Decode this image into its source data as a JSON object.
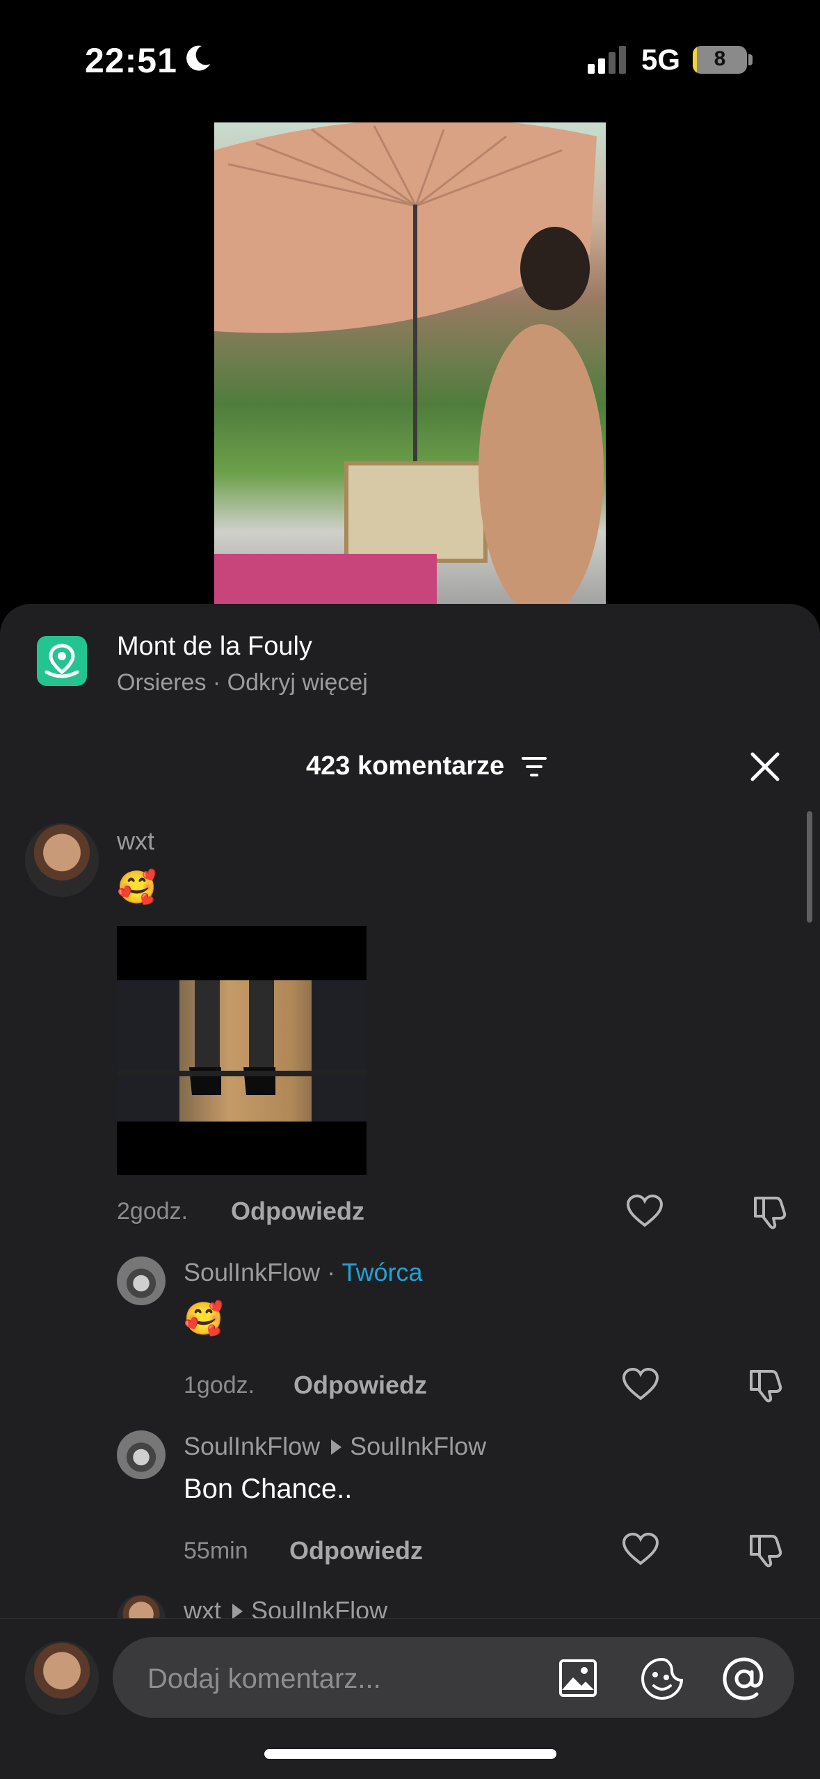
{
  "status_bar": {
    "time": "22:51",
    "network": "5G",
    "battery": 8
  },
  "location": {
    "title": "Mont de la Fouly",
    "subtitle": "Orsieres · Odkryj więcej"
  },
  "comments_header": {
    "count_label": "423 komentarze"
  },
  "comments": [
    {
      "user": "wxt",
      "emoji": "🥰",
      "time": "2godz.",
      "reply_label": "Odpowiedz"
    }
  ],
  "replies": [
    {
      "user": "SoulInkFlow",
      "badge": "Twórca",
      "emoji": "🥰",
      "time": "1godz.",
      "reply_label": "Odpowiedz"
    },
    {
      "user": "SoulInkFlow",
      "reply_to": "SoulInkFlow",
      "text": "Bon Chance..",
      "time": "55min",
      "reply_label": "Odpowiedz"
    },
    {
      "user": "wxt",
      "reply_to": "SoulInkFlow"
    }
  ],
  "composer": {
    "placeholder": "Dodaj komentarz..."
  },
  "icons": [
    "moon-icon",
    "signal-icon",
    "location-pin-icon",
    "sort-icon",
    "close-icon",
    "heart-icon",
    "dislike-icon",
    "image-icon",
    "sticker-icon",
    "mention-icon"
  ],
  "colors": {
    "accent": "#1fa3d8",
    "location_green": "#23c48f",
    "sheet_bg": "#1f1f21"
  }
}
